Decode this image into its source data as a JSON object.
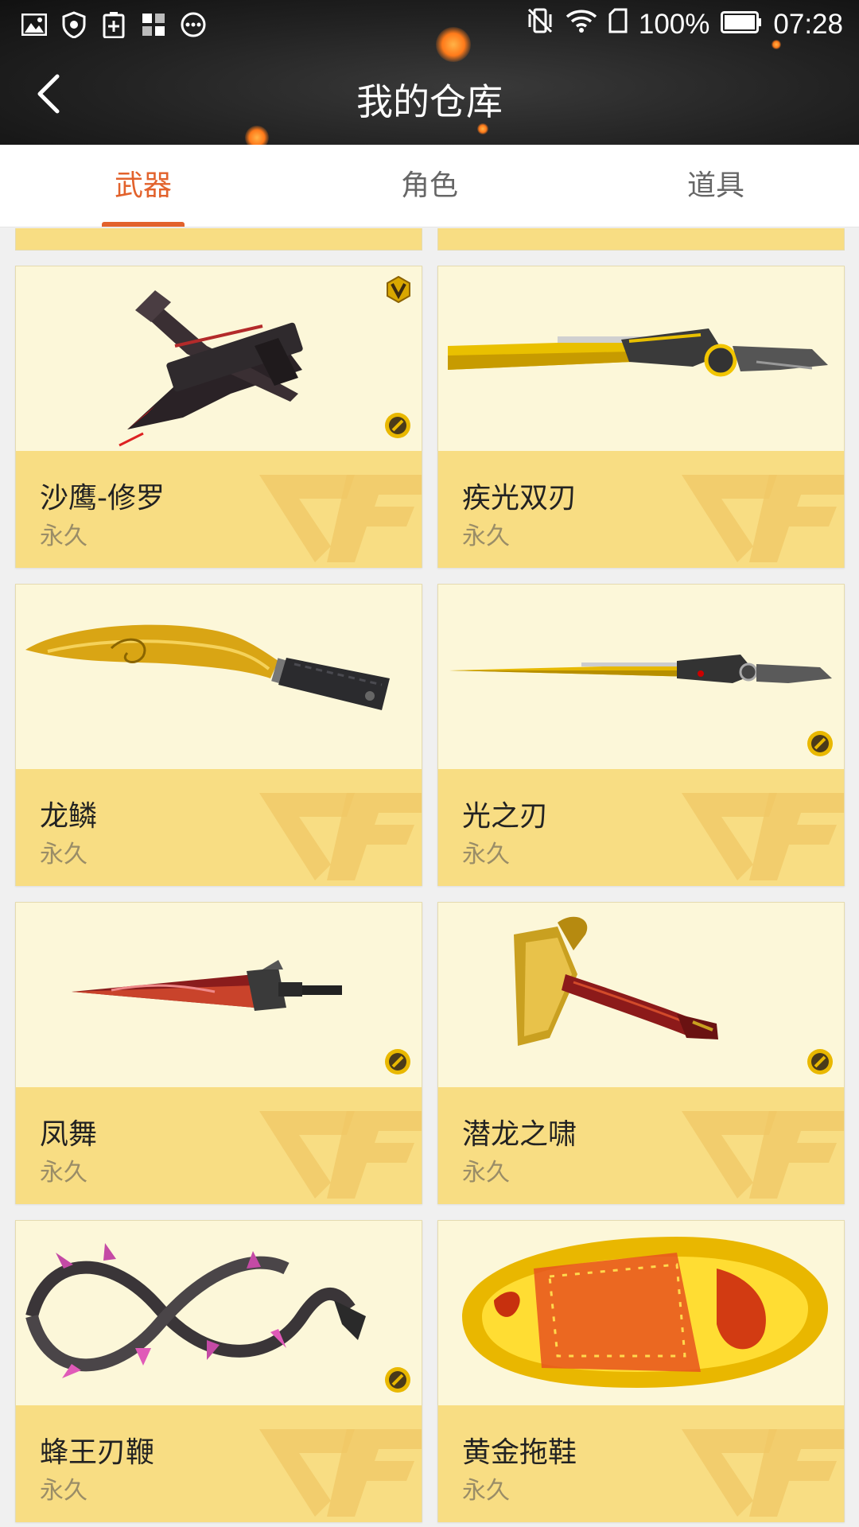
{
  "status": {
    "battery_percent": "100%",
    "time": "07:28"
  },
  "header": {
    "title": "我的仓库"
  },
  "tabs": [
    {
      "label": "武器",
      "active": true
    },
    {
      "label": "角色",
      "active": false
    },
    {
      "label": "道具",
      "active": false
    }
  ],
  "items": [
    {
      "name": "沙鹰-修罗",
      "duration": "永久",
      "vip": true,
      "coin": true,
      "art": "pistol-blade"
    },
    {
      "name": "疾光双刃",
      "duration": "永久",
      "vip": false,
      "coin": false,
      "art": "yellow-blade"
    },
    {
      "name": "龙鳞",
      "duration": "永久",
      "vip": false,
      "coin": false,
      "art": "kukri"
    },
    {
      "name": "光之刃",
      "duration": "永久",
      "vip": false,
      "coin": true,
      "art": "thin-blade"
    },
    {
      "name": "凤舞",
      "duration": "永久",
      "vip": false,
      "coin": true,
      "art": "red-dagger"
    },
    {
      "name": "潜龙之啸",
      "duration": "永久",
      "vip": false,
      "coin": true,
      "art": "dragon-axe"
    },
    {
      "name": "蜂王刃鞭",
      "duration": "永久",
      "vip": false,
      "coin": true,
      "art": "whip"
    },
    {
      "name": "黄金拖鞋",
      "duration": "永久",
      "vip": false,
      "coin": false,
      "art": "slipper"
    }
  ],
  "colors": {
    "accent": "#e2622c",
    "card_top": "#fcf7d9",
    "card_info": "#f8dd83"
  }
}
